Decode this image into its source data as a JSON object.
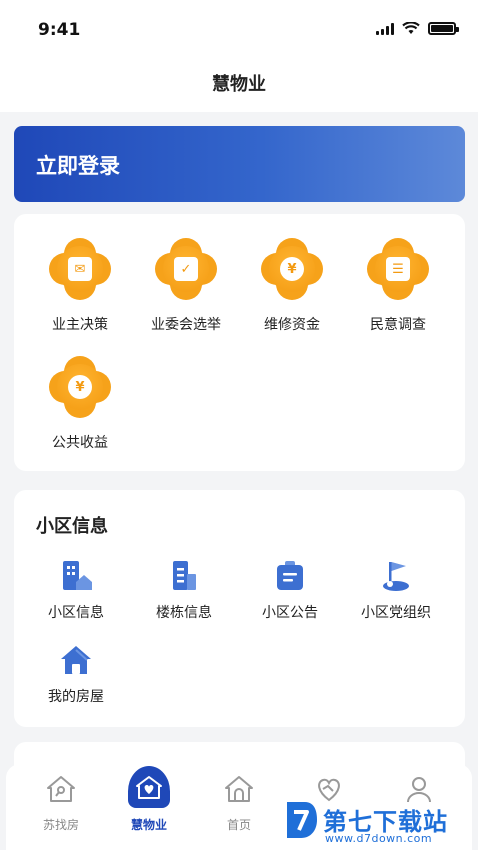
{
  "status_bar": {
    "time": "9:41"
  },
  "header": {
    "title": "慧物业"
  },
  "login_banner": {
    "label": "立即登录"
  },
  "services": [
    {
      "label": "业主决策",
      "icon": "ballot-box-icon"
    },
    {
      "label": "业委会选举",
      "icon": "vote-check-icon"
    },
    {
      "label": "维修资金",
      "icon": "money-bag-icon"
    },
    {
      "label": "民意调查",
      "icon": "clipboard-survey-icon"
    },
    {
      "label": "公共收益",
      "icon": "coins-yen-icon"
    }
  ],
  "community": {
    "title": "小区信息",
    "items": [
      {
        "label": "小区信息",
        "icon": "building-home-icon"
      },
      {
        "label": "楼栋信息",
        "icon": "building-icon"
      },
      {
        "label": "小区公告",
        "icon": "notice-bag-icon"
      },
      {
        "label": "小区党组织",
        "icon": "party-flag-icon"
      },
      {
        "label": "我的房屋",
        "icon": "house-icon"
      }
    ]
  },
  "tabbar": {
    "items": [
      {
        "label": "苏找房",
        "icon": "house-key-icon",
        "active": false
      },
      {
        "label": "慧物业",
        "icon": "heart-home-icon",
        "active": true
      },
      {
        "label": "首页",
        "icon": "home-icon",
        "active": false
      },
      {
        "label": "",
        "icon": "handshake-heart-icon",
        "active": false
      },
      {
        "label": "",
        "icon": "user-icon",
        "active": false
      }
    ]
  },
  "watermark": {
    "title": "第七下载站",
    "url": "www.d7down.com"
  },
  "colors": {
    "primary": "#1f48b8",
    "orange": "#f6a21a",
    "icon_blue": "#3d6fd1"
  }
}
